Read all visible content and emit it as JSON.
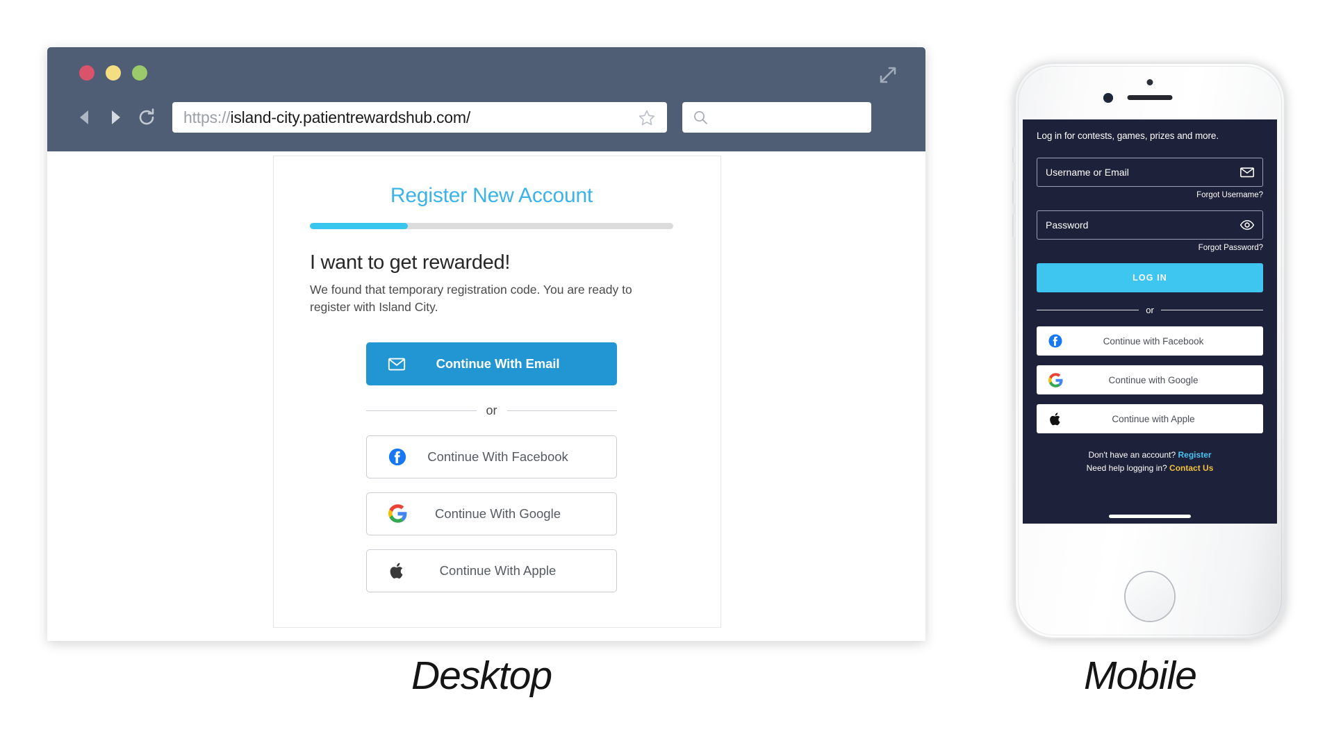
{
  "browser": {
    "traffic_lights": [
      "close-red",
      "minimize-yellow",
      "maximize-green"
    ],
    "expand_icon": "expand-arrows-icon",
    "back_icon": "back-arrow-icon",
    "forward_icon": "forward-arrow-icon",
    "reload_icon": "reload-icon",
    "url_scheme": "https://",
    "url_host": "island-city.patientrewardshub.com/",
    "url_full": "https://island-city.patientrewardshub.com/",
    "star_icon": "star-bookmark-icon",
    "search_icon": "search-icon",
    "search_value": "",
    "search_placeholder": ""
  },
  "desktop": {
    "card": {
      "title": "Register New Account",
      "progress_percent": 27,
      "heading": "I want to get rewarded!",
      "subtext": "We found that temporary registration code. You are ready to register with Island City.",
      "primary_button": {
        "label": "Continue With Email",
        "icon": "envelope-icon"
      },
      "divider_label": "or",
      "social_buttons": [
        {
          "label": "Continue With Facebook",
          "icon": "facebook-icon"
        },
        {
          "label": "Continue With Google",
          "icon": "google-icon"
        },
        {
          "label": "Continue With Apple",
          "icon": "apple-icon"
        }
      ]
    }
  },
  "mobile": {
    "tagline": "Log in for contests, games, prizes and more.",
    "username_field": {
      "placeholder": "Username or Email",
      "value": "",
      "icon": "envelope-icon"
    },
    "forgot_username": "Forgot Username?",
    "password_field": {
      "placeholder": "Password",
      "value": "",
      "icon": "eye-icon"
    },
    "forgot_password": "Forgot Password?",
    "login_button": "LOG IN",
    "divider_label": "or",
    "social_buttons": [
      {
        "label": "Continue with Facebook",
        "icon": "facebook-icon"
      },
      {
        "label": "Continue with Google",
        "icon": "google-icon"
      },
      {
        "label": "Continue with Apple",
        "icon": "apple-icon"
      }
    ],
    "footer": {
      "register_prompt": "Don't have an account?",
      "register_link": "Register",
      "help_prompt": "Need help logging in?",
      "contact_link": "Contact Us"
    }
  },
  "captions": {
    "desktop": "Desktop",
    "mobile": "Mobile"
  },
  "colors": {
    "chrome": "#4f5d75",
    "accent_blue": "#38c6ef",
    "primary_button": "#2196d3",
    "title_blue": "#3bb3e8",
    "mobile_bg": "#1d2139",
    "register_link": "#49c3f1",
    "contact_link": "#f0c13b"
  }
}
